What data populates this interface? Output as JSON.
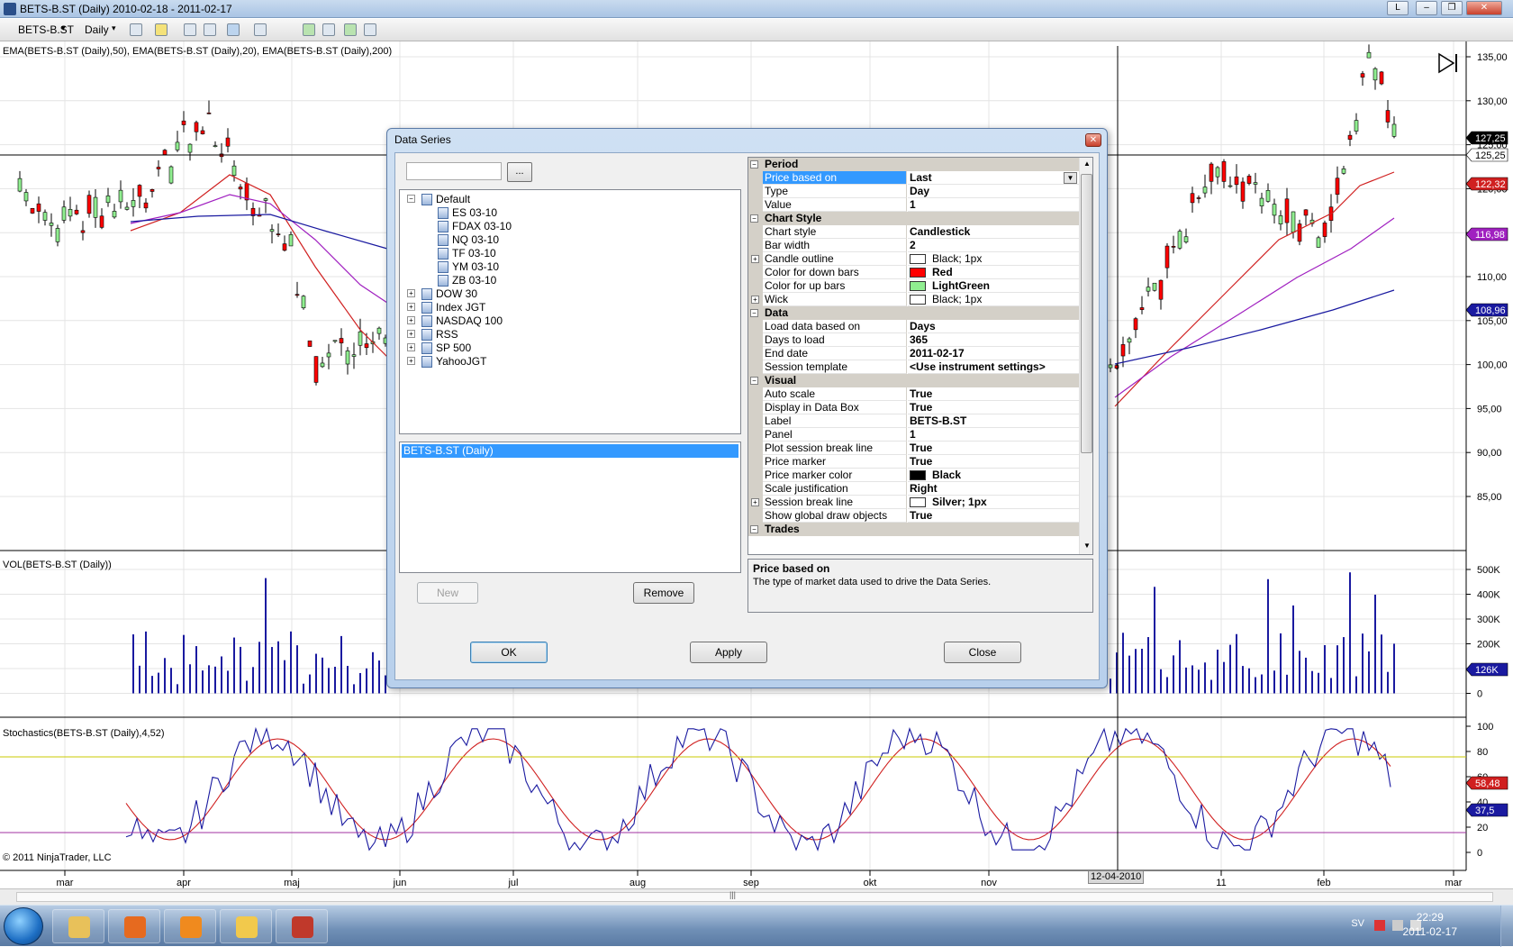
{
  "window": {
    "title": "BETS-B.ST (Daily)  2010-02-18 - 2011-02-17",
    "controls": [
      "L",
      "–",
      "❐",
      "✕"
    ]
  },
  "toolbar": {
    "instrument": "BETS-B.ST",
    "period": "Daily"
  },
  "chart": {
    "price_panel_label": "EMA(BETS-B.ST (Daily),50), EMA(BETS-B.ST (Daily),20), EMA(BETS-B.ST (Daily),200)",
    "volume_panel_label": "VOL(BETS-B.ST (Daily))",
    "stoch_panel_label": "Stochastics(BETS-B.ST (Daily),4,52)",
    "copyright": "© 2011 NinjaTrader, LLC",
    "price_ticks": [
      "135,00",
      "130,00",
      "125,00",
      "120,00",
      "115,00",
      "110,00",
      "105,00",
      "100,00",
      "95,00",
      "90,00",
      "85,00"
    ],
    "volume_ticks": [
      "500K",
      "400K",
      "300K",
      "200K",
      "100K",
      "0"
    ],
    "stoch_ticks": [
      "100",
      "80",
      "60",
      "40",
      "20",
      "0"
    ],
    "x_ticks": [
      "mar",
      "apr",
      "maj",
      "jun",
      "jul",
      "aug",
      "sep",
      "okt",
      "nov",
      "11",
      "feb",
      "mar"
    ],
    "crosshair_date": "12-04-2010",
    "markers": {
      "crosshair_price": {
        "text": "125,25",
        "color": "#ffffff"
      },
      "last": {
        "text": "127,25",
        "color": "#000000"
      },
      "ema20": {
        "text": "122,32",
        "color": "#d02020"
      },
      "ema50": {
        "text": "116,98",
        "color": "#a020c0"
      },
      "ema200": {
        "text": "108,96",
        "color": "#1a1aa0"
      },
      "volume": {
        "text": "126K",
        "color": "#1a1aa0"
      },
      "stoch_d": {
        "text": "58,48",
        "color": "#d02020"
      },
      "stoch_k": {
        "text": "37,5",
        "color": "#1a1aa0"
      }
    },
    "chart_data": {
      "type": "line",
      "ylim": [
        85,
        135
      ],
      "series": [
        {
          "name": "EMA(BETS-B.ST (Daily),20)",
          "color": "#d02020"
        },
        {
          "name": "EMA(BETS-B.ST (Daily),50)",
          "color": "#a020c0"
        },
        {
          "name": "EMA(BETS-B.ST (Daily),200)",
          "color": "#1a1aa0"
        }
      ]
    }
  },
  "dialog": {
    "title": "Data Series",
    "close_glyph": "✕",
    "browse_label": "...",
    "tree": [
      {
        "label": "Default",
        "expanded": true,
        "children": [
          "ES 03-10",
          "FDAX 03-10",
          "NQ 03-10",
          "TF 03-10",
          "YM 03-10",
          "ZB 03-10"
        ]
      },
      {
        "label": "DOW 30",
        "expanded": false
      },
      {
        "label": "Index JGT",
        "expanded": false
      },
      {
        "label": "NASDAQ 100",
        "expanded": false
      },
      {
        "label": "RSS",
        "expanded": false
      },
      {
        "label": "SP 500",
        "expanded": false
      },
      {
        "label": "YahooJGT",
        "expanded": false
      }
    ],
    "selected_series": "BETS-B.ST (Daily)",
    "new_label": "New",
    "remove_label": "Remove",
    "ok_label": "OK",
    "apply_label": "Apply",
    "close_label": "Close",
    "properties": [
      {
        "category": "Period"
      },
      {
        "name": "Price based on",
        "value": "Last",
        "selected": true,
        "dropdown": true
      },
      {
        "name": "Type",
        "value": "Day"
      },
      {
        "name": "Value",
        "value": "1"
      },
      {
        "category": "Chart Style"
      },
      {
        "name": "Chart style",
        "value": "Candlestick"
      },
      {
        "name": "Bar width",
        "value": "2"
      },
      {
        "name": "Candle outline",
        "value": "Black; 1px",
        "swatch": "#ffffff",
        "expand": true,
        "normal": true
      },
      {
        "name": "Color for down bars",
        "value": "Red",
        "swatch": "#ff0000"
      },
      {
        "name": "Color for up bars",
        "value": "LightGreen",
        "swatch": "#90ee90"
      },
      {
        "name": "Wick",
        "value": "Black; 1px",
        "swatch": "#ffffff",
        "expand": true,
        "normal": true
      },
      {
        "category": "Data"
      },
      {
        "name": "Load data based on",
        "value": "Days"
      },
      {
        "name": "Days to load",
        "value": "365"
      },
      {
        "name": "End date",
        "value": "2011-02-17"
      },
      {
        "name": "Session template",
        "value": "<Use instrument settings>"
      },
      {
        "category": "Visual"
      },
      {
        "name": "Auto scale",
        "value": "True"
      },
      {
        "name": "Display in Data Box",
        "value": "True"
      },
      {
        "name": "Label",
        "value": "BETS-B.ST"
      },
      {
        "name": "Panel",
        "value": "1"
      },
      {
        "name": "Plot session break line",
        "value": "True"
      },
      {
        "name": "Price marker",
        "value": "True"
      },
      {
        "name": "Price marker color",
        "value": "Black",
        "swatch": "#000000"
      },
      {
        "name": "Scale justification",
        "value": "Right"
      },
      {
        "name": "Session break line",
        "value": "Silver; 1px",
        "swatch": "#ffffff",
        "expand": true
      },
      {
        "name": "Show global draw objects",
        "value": "True"
      },
      {
        "category": "Trades"
      }
    ],
    "description_title": "Price based on",
    "description_text": "The type of market data used to drive the Data Series."
  },
  "taskbar": {
    "language": "SV",
    "time": "22:29",
    "date": "2011-02-17",
    "apps": [
      {
        "name": "explorer",
        "color": "#e8c15a"
      },
      {
        "name": "firefox",
        "color": "#e66a1f"
      },
      {
        "name": "media-player",
        "color": "#f08a1e"
      },
      {
        "name": "outlook",
        "color": "#f2c94c"
      },
      {
        "name": "ninjatrader",
        "color": "#c0392b"
      }
    ]
  }
}
